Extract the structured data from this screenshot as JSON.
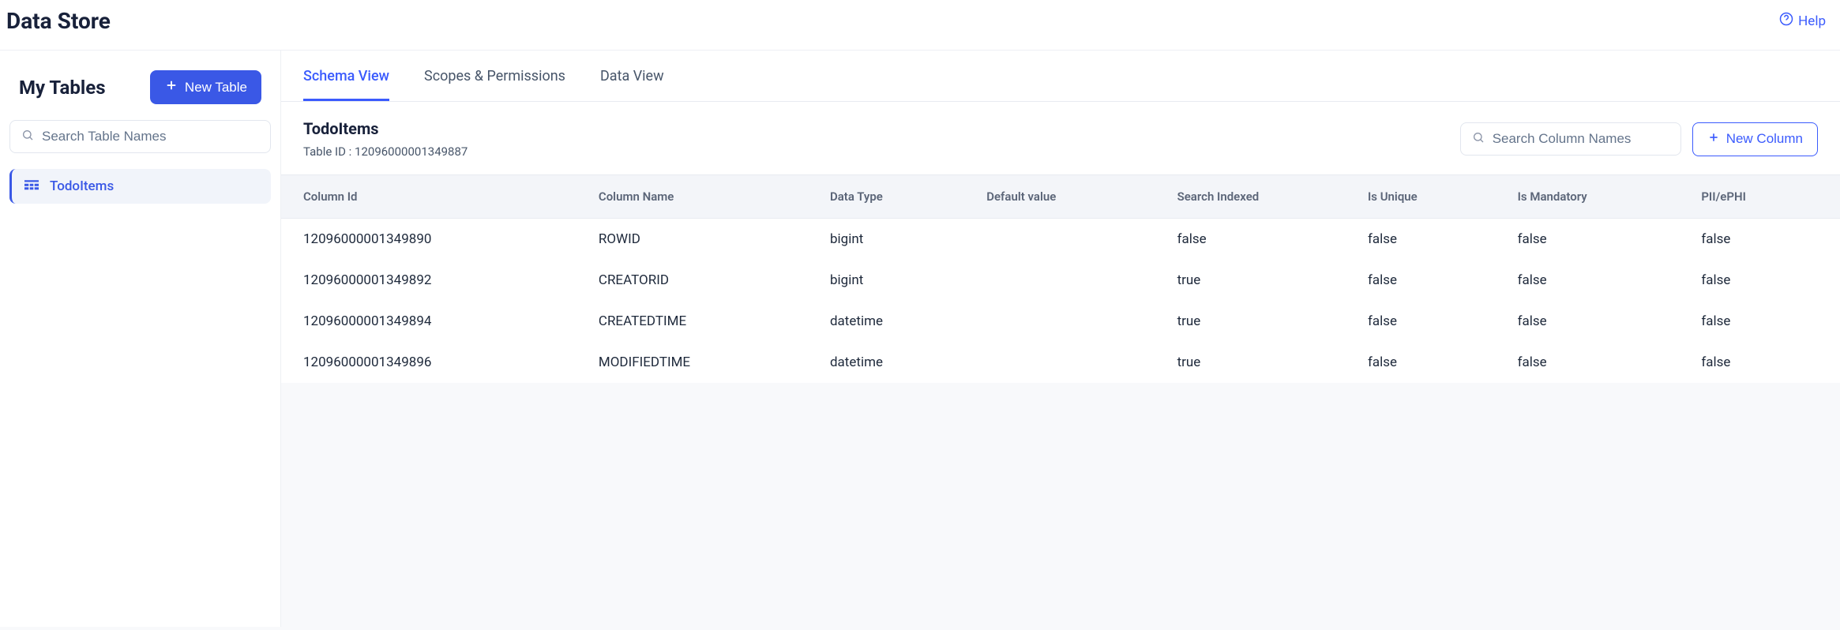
{
  "header": {
    "title": "Data Store",
    "help_label": "Help"
  },
  "sidebar": {
    "title": "My Tables",
    "new_table_label": "New Table",
    "search_placeholder": "Search Table Names",
    "items": [
      {
        "label": "TodoItems"
      }
    ]
  },
  "tabs": [
    {
      "label": "Schema View",
      "active": true
    },
    {
      "label": "Scopes & Permissions",
      "active": false
    },
    {
      "label": "Data View",
      "active": false
    }
  ],
  "toolbar": {
    "table_name": "TodoItems",
    "table_id_prefix": "Table ID : ",
    "table_id_value": "12096000001349887",
    "search_placeholder": "Search Column Names",
    "new_column_label": "New Column"
  },
  "table": {
    "headers": [
      "Column Id",
      "Column Name",
      "Data Type",
      "Default value",
      "Search Indexed",
      "Is Unique",
      "Is Mandatory",
      "PII/ePHI"
    ],
    "rows": [
      {
        "column_id": "12096000001349890",
        "column_name": "ROWID",
        "data_type": "bigint",
        "default_value": "",
        "search_indexed": "false",
        "is_unique": "false",
        "is_mandatory": "false",
        "pii": "false"
      },
      {
        "column_id": "12096000001349892",
        "column_name": "CREATORID",
        "data_type": "bigint",
        "default_value": "",
        "search_indexed": "true",
        "is_unique": "false",
        "is_mandatory": "false",
        "pii": "false"
      },
      {
        "column_id": "12096000001349894",
        "column_name": "CREATEDTIME",
        "data_type": "datetime",
        "default_value": "",
        "search_indexed": "true",
        "is_unique": "false",
        "is_mandatory": "false",
        "pii": "false"
      },
      {
        "column_id": "12096000001349896",
        "column_name": "MODIFIEDTIME",
        "data_type": "datetime",
        "default_value": "",
        "search_indexed": "true",
        "is_unique": "false",
        "is_mandatory": "false",
        "pii": "false"
      }
    ]
  }
}
